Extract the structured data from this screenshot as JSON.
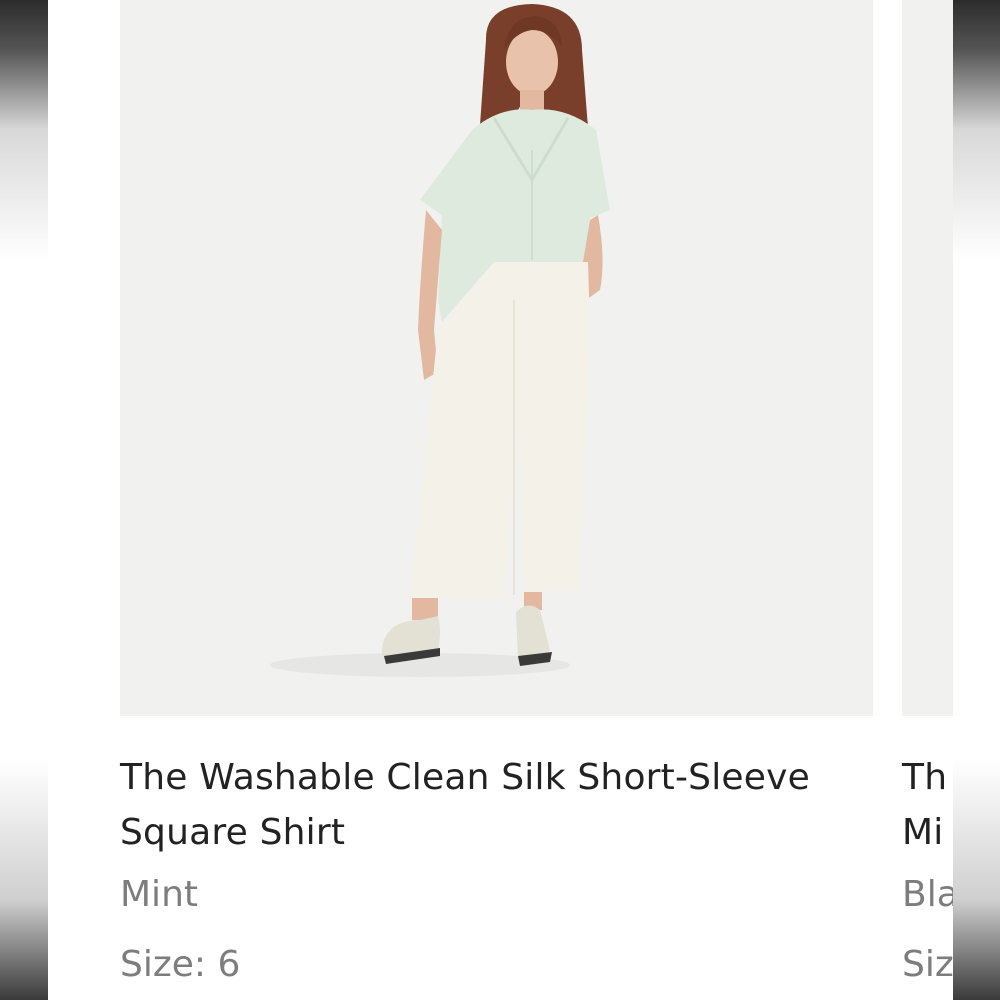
{
  "products": [
    {
      "title": "The Washable Clean Silk Short-Sleeve Square Shirt",
      "color": "Mint",
      "size_label": "Size: 6"
    },
    {
      "title_line1": "Th",
      "title_line2": "Mi",
      "color": "Bla",
      "size_label": "Siz"
    }
  ],
  "colors": {
    "photo_background": "#f1f1f0",
    "shirt": "#dfeadf",
    "pants": "#f4f1e8",
    "title_text": "#222222",
    "meta_text": "#7d7d7d"
  }
}
